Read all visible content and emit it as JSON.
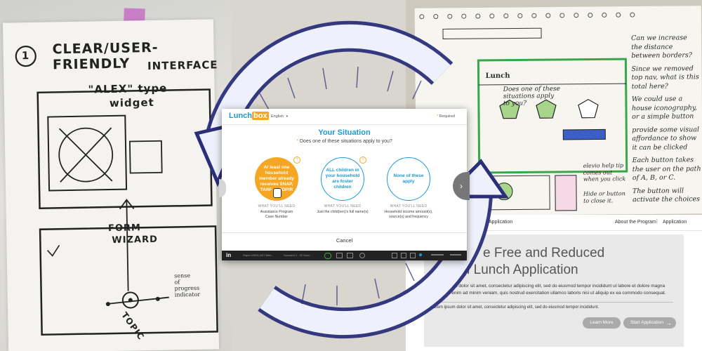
{
  "left_sketch": {
    "step_number": "1",
    "heading_line1": "CLEAR/USER-FRIENDLY",
    "heading_line2": "INTERFACE",
    "widget_note_line1": "\"ALEX\" type",
    "widget_note_line2": "widget",
    "form_note_line1": "FORM",
    "form_note_line2": "WIZARD",
    "topic_note": "TOPIC",
    "progress_note_line1": "sense",
    "progress_note_line2": "of",
    "progress_note_line3": "progress",
    "progress_note_line4": "indicator"
  },
  "right_sketch": {
    "logo": "Lunch",
    "question_line1": "Does one of these",
    "question_line2": "situations apply",
    "question_line3": "to you?",
    "notes": [
      "Can we increase the distance between borders?",
      "Since we removed top nav, what is this total here?",
      "We could use a house iconography, or a simple button",
      "provide some visual affordance to show it can be clicked",
      "Each button takes the user on the path of A, B, or C.",
      "The button will activate the choices"
    ],
    "elevio_note": "elevio help tip comes out when you click",
    "hide_note": "Hide or button to close it."
  },
  "modal": {
    "logo_part1": "Lunch",
    "logo_part2": "box",
    "language": "English",
    "required_label": "Required",
    "title": "Your Situation",
    "question": "Does one of these situations apply to you?",
    "options": [
      {
        "text": "At least one household member already receives SNAP, TANF or FDPIR",
        "need_label": "WHAT YOU'LL NEED",
        "need": "Assistance Program Case Number"
      },
      {
        "text": "ALL children in your household are foster children",
        "need_label": "WHAT YOU'LL NEED",
        "need": "Just the child(ren)'s full name(s)"
      },
      {
        "text": "None of these apply",
        "need_label": "WHAT YOU'LL NEED",
        "need": "Household income amount(s), source(s) and frequency"
      }
    ],
    "cancel": "Cancel",
    "accent": "#f5a623",
    "blue": "#1a9ad6"
  },
  "invision_bar": {
    "logo": "in",
    "item1": "Rapid USDA 24/7 Web...",
    "item2": "Scenario 1 - 02 Scen..."
  },
  "right_app": {
    "nav_left": "Application",
    "nav_about": "About the Program",
    "nav_divider": "|",
    "nav_application": "Application",
    "title_line1": "e Free and Reduced",
    "title_line2": "ool Lunch Application",
    "paragraph": "Lorem ipsum dolor sit amet, consectetur adipiscing elit, sed do eiusmod tempor incididunt ut labore et dolore magna aliqua. Ut enim ad minim veniam, quis nostrud exercitation ullamco laboris nisi ut aliquip ex ea commodo consequat.",
    "paragraph2": "Lorem ipsum dolor sit amet, consectetur adipiscing elit, sed do eiusmod tempor incididunt.",
    "learn_more": "Learn More",
    "start_application": "Start Application",
    "arrow": "→"
  },
  "colors": {
    "cycle_arrow": "#2b2f7a",
    "sketch_green": "#3aa64a"
  }
}
